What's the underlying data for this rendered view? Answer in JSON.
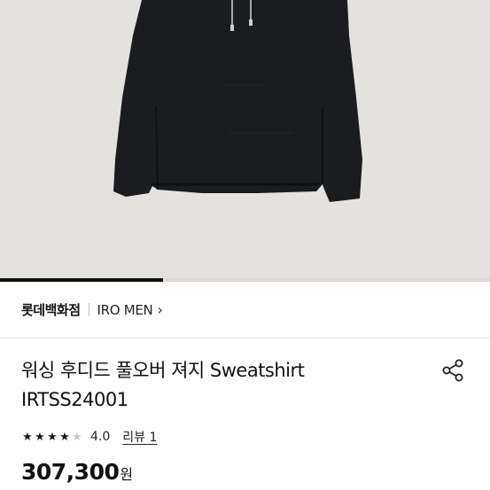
{
  "image": {
    "description_icon": "hoodie-image",
    "progress_fraction": 0.333
  },
  "store": {
    "name": "롯데백화점",
    "brand": "IRO MEN",
    "brand_chevron": "›"
  },
  "product": {
    "title_line1": "워싱 후디드 풀오버 져지 Sweatshirt",
    "title_line2": "IRTSS24001",
    "share_icon": "share-icon"
  },
  "rating": {
    "stars_filled": 4,
    "stars_total": 5,
    "value": "4.0",
    "review_label": "리뷰 1"
  },
  "price": {
    "amount": "307,300",
    "unit": "원"
  },
  "colors": {
    "accent": "#111111",
    "image_bg": "#e4e2df",
    "garment": "#1b1c20"
  }
}
